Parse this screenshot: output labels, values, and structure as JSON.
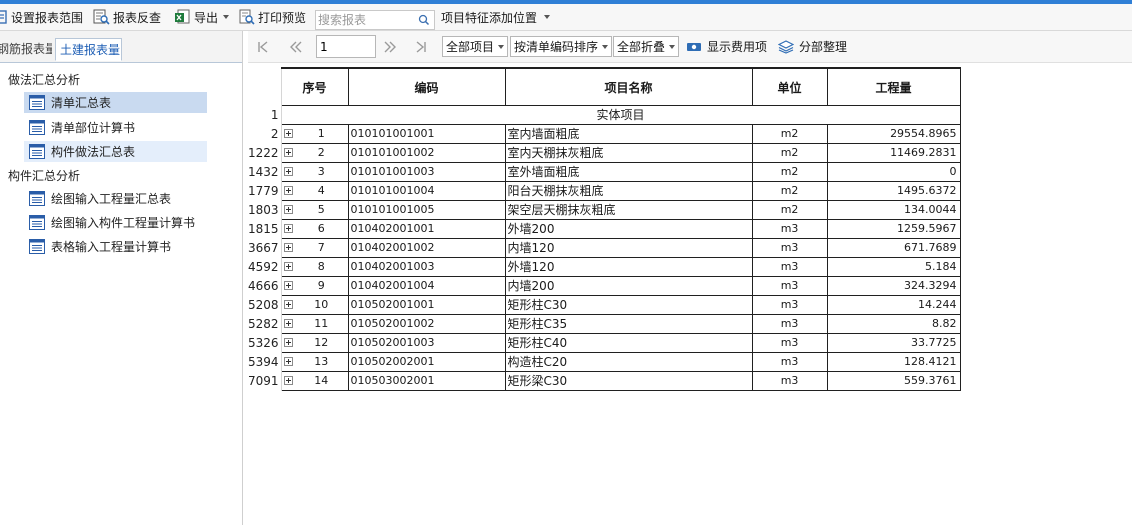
{
  "toolbar": {
    "set_range": "设置报表范围",
    "report_check": "报表反查",
    "export": "导出",
    "print_preview": "打印预览",
    "search_placeholder": "搜索报表",
    "feature_position": "项目特征添加位置"
  },
  "left_panel": {
    "tabs": [
      "钢筋报表量",
      "土建报表量"
    ],
    "groups": [
      {
        "title": "做法汇总分析",
        "items": [
          "清单汇总表",
          "清单部位计算书",
          "构件做法汇总表"
        ]
      },
      {
        "title": "构件汇总分析",
        "items": [
          "绘图输入工程量汇总表",
          "绘图输入构件工程量计算书",
          "表格输入工程量计算书"
        ]
      }
    ]
  },
  "report_toolbar": {
    "page_value": "1",
    "filter_all_items": "全部项目",
    "sort_by_code": "按清单编码排序",
    "collapse_all": "全部折叠",
    "show_fee_items": "显示费用项",
    "subsection_arrange": "分部整理"
  },
  "table": {
    "headers": [
      "序号",
      "编码",
      "项目名称",
      "单位",
      "工程量"
    ],
    "section_row": {
      "row_id": "1",
      "label": "实体项目"
    },
    "rows": [
      {
        "row_id": "2",
        "seq": "1",
        "code": "010101001001",
        "name": "室内墙面粗底",
        "unit": "m2",
        "qty": "29554.8965"
      },
      {
        "row_id": "1222",
        "seq": "2",
        "code": "010101001002",
        "name": "室内天棚抹灰粗底",
        "unit": "m2",
        "qty": "11469.2831"
      },
      {
        "row_id": "1432",
        "seq": "3",
        "code": "010101001003",
        "name": "室外墙面粗底",
        "unit": "m2",
        "qty": "0"
      },
      {
        "row_id": "1779",
        "seq": "4",
        "code": "010101001004",
        "name": "阳台天棚抹灰粗底",
        "unit": "m2",
        "qty": "1495.6372"
      },
      {
        "row_id": "1803",
        "seq": "5",
        "code": "010101001005",
        "name": "架空层天棚抹灰粗底",
        "unit": "m2",
        "qty": "134.0044"
      },
      {
        "row_id": "1815",
        "seq": "6",
        "code": "010402001001",
        "name": "外墙200",
        "unit": "m3",
        "qty": "1259.5967"
      },
      {
        "row_id": "3667",
        "seq": "7",
        "code": "010402001002",
        "name": "内墙120",
        "unit": "m3",
        "qty": "671.7689"
      },
      {
        "row_id": "4592",
        "seq": "8",
        "code": "010402001003",
        "name": "外墙120",
        "unit": "m3",
        "qty": "5.184"
      },
      {
        "row_id": "4666",
        "seq": "9",
        "code": "010402001004",
        "name": "内墙200",
        "unit": "m3",
        "qty": "324.3294"
      },
      {
        "row_id": "5208",
        "seq": "10",
        "code": "010502001001",
        "name": "矩形柱C30",
        "unit": "m3",
        "qty": "14.244"
      },
      {
        "row_id": "5282",
        "seq": "11",
        "code": "010502001002",
        "name": "矩形柱C35",
        "unit": "m3",
        "qty": "8.82"
      },
      {
        "row_id": "5326",
        "seq": "12",
        "code": "010502001003",
        "name": "矩形柱C40",
        "unit": "m3",
        "qty": "33.7725"
      },
      {
        "row_id": "5394",
        "seq": "13",
        "code": "010502002001",
        "name": "构造柱C20",
        "unit": "m3",
        "qty": "128.4121"
      },
      {
        "row_id": "7091",
        "seq": "14",
        "code": "010503002001",
        "name": "矩形梁C30",
        "unit": "m3",
        "qty": "559.3761"
      }
    ]
  },
  "colors": {
    "accent_blue": "#2f7fd6",
    "selected_bg": "#c9daf0",
    "hover_bg": "#e4eefb",
    "tab_text": "#1f5fb5"
  }
}
